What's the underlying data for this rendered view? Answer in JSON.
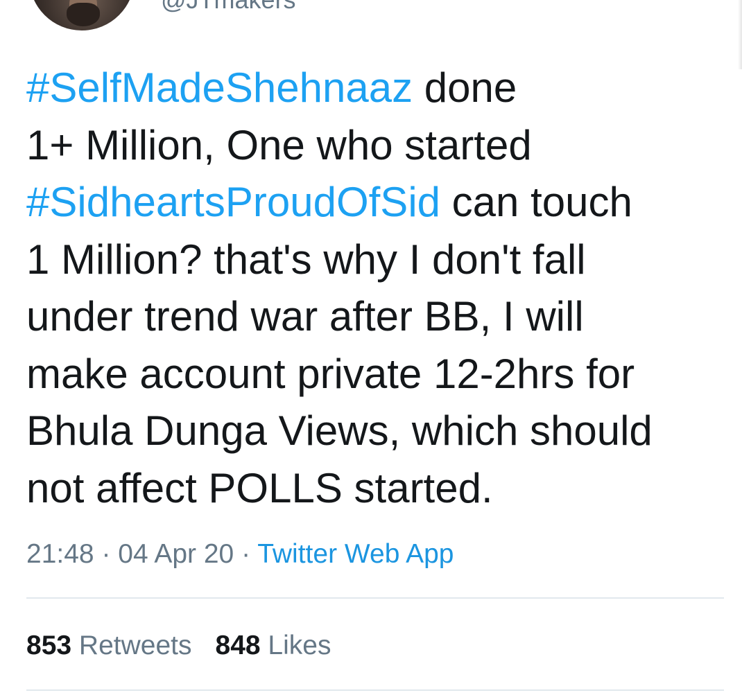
{
  "author": {
    "handle": "@JTmakers"
  },
  "tweet": {
    "lines": [
      {
        "hashtag": "#SelfMadeShehnaaz",
        "text": " done"
      },
      {
        "hashtag": "",
        "text": "1+ Million, One who started"
      },
      {
        "hashtag": "#SidheartsProudOfSid",
        "text": " can touch"
      },
      {
        "hashtag": "",
        "text": "1 Million? that's why I don't fall"
      },
      {
        "hashtag": "",
        "text": "under trend war after BB, I will"
      },
      {
        "hashtag": "",
        "text": "make account private 12-2hrs for"
      },
      {
        "hashtag": "",
        "text": "Bhula Dunga Views, which should"
      },
      {
        "hashtag": "",
        "text": "not affect POLLS started."
      }
    ],
    "time": "21:48",
    "separator": " · ",
    "date": "04 Apr 20",
    "source": "Twitter Web App"
  },
  "stats": {
    "retweets_count": "853",
    "retweets_label": "Retweets",
    "likes_count": "848",
    "likes_label": "Likes"
  },
  "colors": {
    "hashtag": "#1da1f2",
    "source_link": "#1b95e0",
    "muted": "#657786",
    "text": "#14171a",
    "divider": "#e1e8ed"
  }
}
